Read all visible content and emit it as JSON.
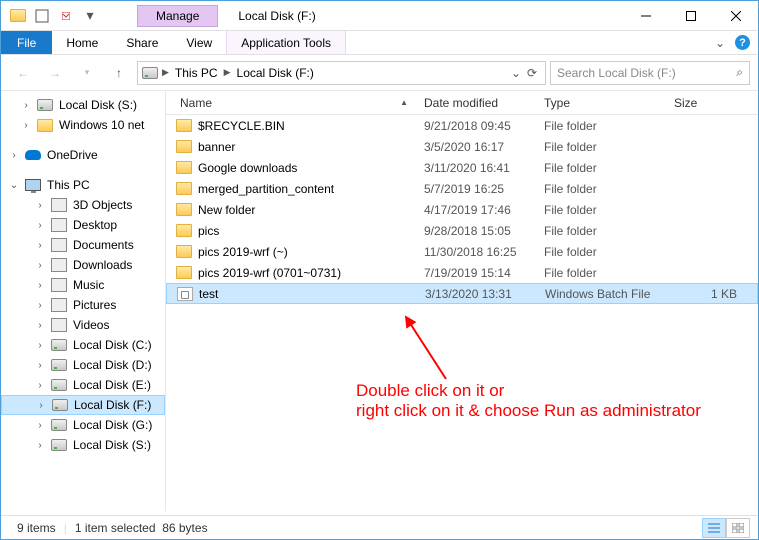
{
  "window": {
    "title": "Local Disk (F:)",
    "context_tab": "Manage"
  },
  "ribbon": {
    "file": "File",
    "tabs": [
      "Home",
      "Share",
      "View"
    ],
    "app_tools": "Application Tools"
  },
  "address": {
    "crumbs": [
      "This PC",
      "Local Disk (F:)"
    ],
    "search_placeholder": "Search Local Disk (F:)"
  },
  "sidebar": {
    "quick": [
      {
        "label": "Local Disk (S:)",
        "icon": "drive"
      },
      {
        "label": "Windows 10 net",
        "icon": "folder"
      }
    ],
    "onedrive": {
      "label": "OneDrive"
    },
    "thispc": {
      "label": "This PC"
    },
    "pc_children": [
      {
        "label": "3D Objects",
        "icon": "generic"
      },
      {
        "label": "Desktop",
        "icon": "generic"
      },
      {
        "label": "Documents",
        "icon": "generic"
      },
      {
        "label": "Downloads",
        "icon": "generic"
      },
      {
        "label": "Music",
        "icon": "generic"
      },
      {
        "label": "Pictures",
        "icon": "generic"
      },
      {
        "label": "Videos",
        "icon": "generic"
      },
      {
        "label": "Local Disk (C:)",
        "icon": "drive"
      },
      {
        "label": "Local Disk (D:)",
        "icon": "drive"
      },
      {
        "label": "Local Disk (E:)",
        "icon": "drive"
      },
      {
        "label": "Local Disk (F:)",
        "icon": "drive",
        "selected": true
      },
      {
        "label": "Local Disk (G:)",
        "icon": "drive"
      },
      {
        "label": "Local Disk (S:)",
        "icon": "drive"
      }
    ]
  },
  "columns": {
    "name": "Name",
    "date": "Date modified",
    "type": "Type",
    "size": "Size"
  },
  "files": [
    {
      "name": "$RECYCLE.BIN",
      "date": "9/21/2018 09:45",
      "type": "File folder",
      "size": "",
      "icon": "folder"
    },
    {
      "name": "banner",
      "date": "3/5/2020 16:17",
      "type": "File folder",
      "size": "",
      "icon": "folder"
    },
    {
      "name": "Google downloads",
      "date": "3/11/2020 16:41",
      "type": "File folder",
      "size": "",
      "icon": "folder"
    },
    {
      "name": "merged_partition_content",
      "date": "5/7/2019 16:25",
      "type": "File folder",
      "size": "",
      "icon": "folder"
    },
    {
      "name": "New folder",
      "date": "4/17/2019 17:46",
      "type": "File folder",
      "size": "",
      "icon": "folder"
    },
    {
      "name": "pics",
      "date": "9/28/2018 15:05",
      "type": "File folder",
      "size": "",
      "icon": "folder"
    },
    {
      "name": "pics 2019-wrf (~)",
      "date": "11/30/2018 16:25",
      "type": "File folder",
      "size": "",
      "icon": "folder"
    },
    {
      "name": "pics 2019-wrf (0701~0731)",
      "date": "7/19/2019 15:14",
      "type": "File folder",
      "size": "",
      "icon": "folder"
    },
    {
      "name": "test",
      "date": "3/13/2020 13:31",
      "type": "Windows Batch File",
      "size": "1 KB",
      "icon": "file",
      "selected": true
    }
  ],
  "status": {
    "items": "9 items",
    "selected": "1 item selected",
    "size": "86 bytes"
  },
  "annotation": {
    "line1": "Double click on it or",
    "line2": "right click on it & choose Run as administrator"
  }
}
